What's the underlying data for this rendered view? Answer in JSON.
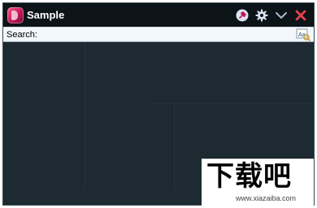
{
  "window": {
    "title": "Sample",
    "icons": {
      "app": "app-logo-icon",
      "pin": "pin-icon",
      "settings": "gear-icon",
      "collapse": "chevron-down-icon",
      "close": "close-icon",
      "search_options": "text-search-options-icon"
    }
  },
  "search": {
    "label": "Search:",
    "value": "",
    "placeholder": ""
  },
  "watermark": {
    "text": "下载吧",
    "url": "www.xiazaiba.com"
  },
  "colors": {
    "titlebar_bg": "#0c1418",
    "content_bg": "#1e2a31",
    "close_red": "#e8414b",
    "icon_light": "#dbe3f3"
  }
}
